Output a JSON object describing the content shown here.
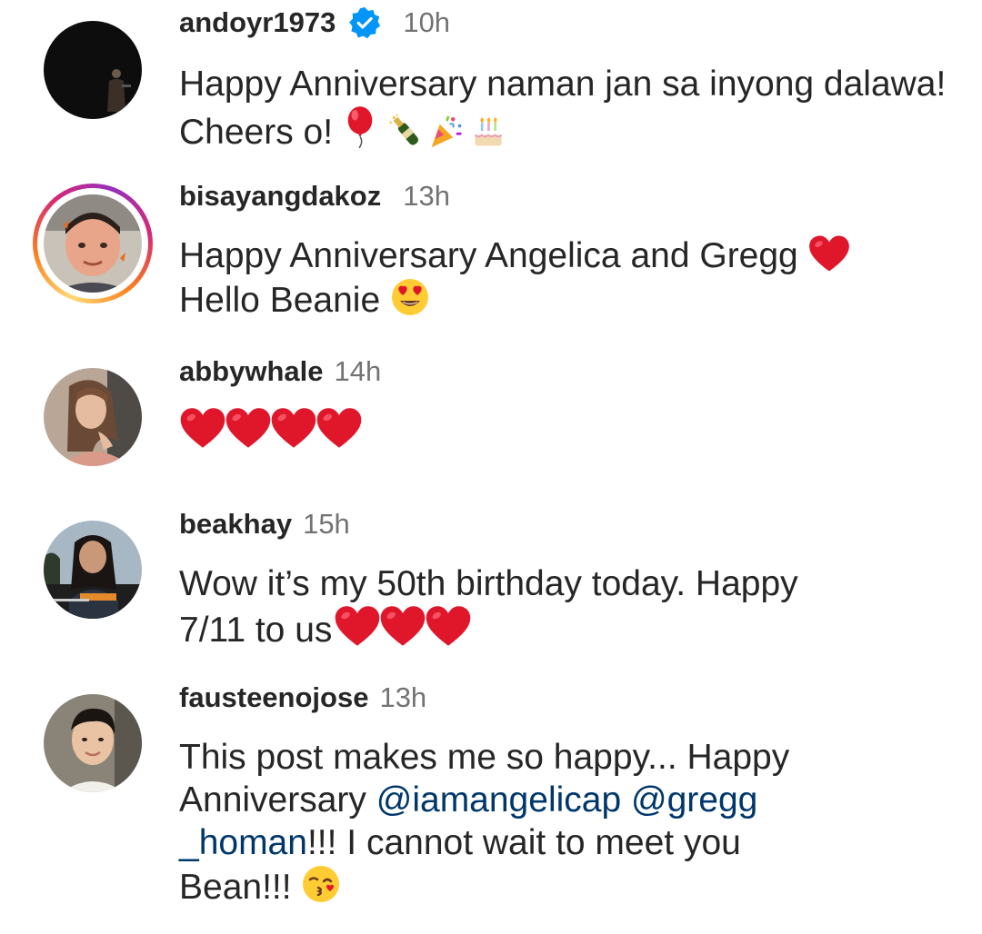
{
  "comments": [
    {
      "username": "andoyr1973",
      "verified": true,
      "time": "10h",
      "text": "Happy Anniversary naman jan sa inyong dalawa! Cheers o!",
      "emojis": [
        "balloon",
        "champagne",
        "party-popper",
        "birthday-cake"
      ]
    },
    {
      "username": "bisayangdakoz",
      "verified": false,
      "has_story": true,
      "time": "13h",
      "text_line1": "Happy Anniversary Angelica and Gregg",
      "text_line2": "Hello Beanie",
      "emojis": [
        "red-heart",
        "heart-eyes"
      ]
    },
    {
      "username": "abbywhale",
      "verified": false,
      "time": "14h",
      "emojis": [
        "red-heart",
        "red-heart",
        "red-heart",
        "red-heart"
      ]
    },
    {
      "username": "beakhay",
      "verified": false,
      "time": "15h",
      "text_line1": "Wow it’s my 50th birthday today. Happy",
      "text_line2": "7/11 to us",
      "emojis": [
        "red-heart",
        "red-heart",
        "red-heart"
      ]
    },
    {
      "username": "fausteenojose",
      "verified": false,
      "time": "13h",
      "text_line1": "This post makes me so happy... Happy",
      "text_line2_prefix": "Anniversary ",
      "mention1": "@iamangelicap",
      "mention2_part1": "@gregg",
      "mention2_part2": "_homan",
      "text_line3_suffix": "!!! I cannot wait to meet you",
      "text_line4": "Bean!!!",
      "emojis": [
        "kissing-face"
      ]
    }
  ],
  "colors": {
    "text": "#262626",
    "secondary": "#737373",
    "mention": "#00376b",
    "verified": "#0095f6"
  }
}
